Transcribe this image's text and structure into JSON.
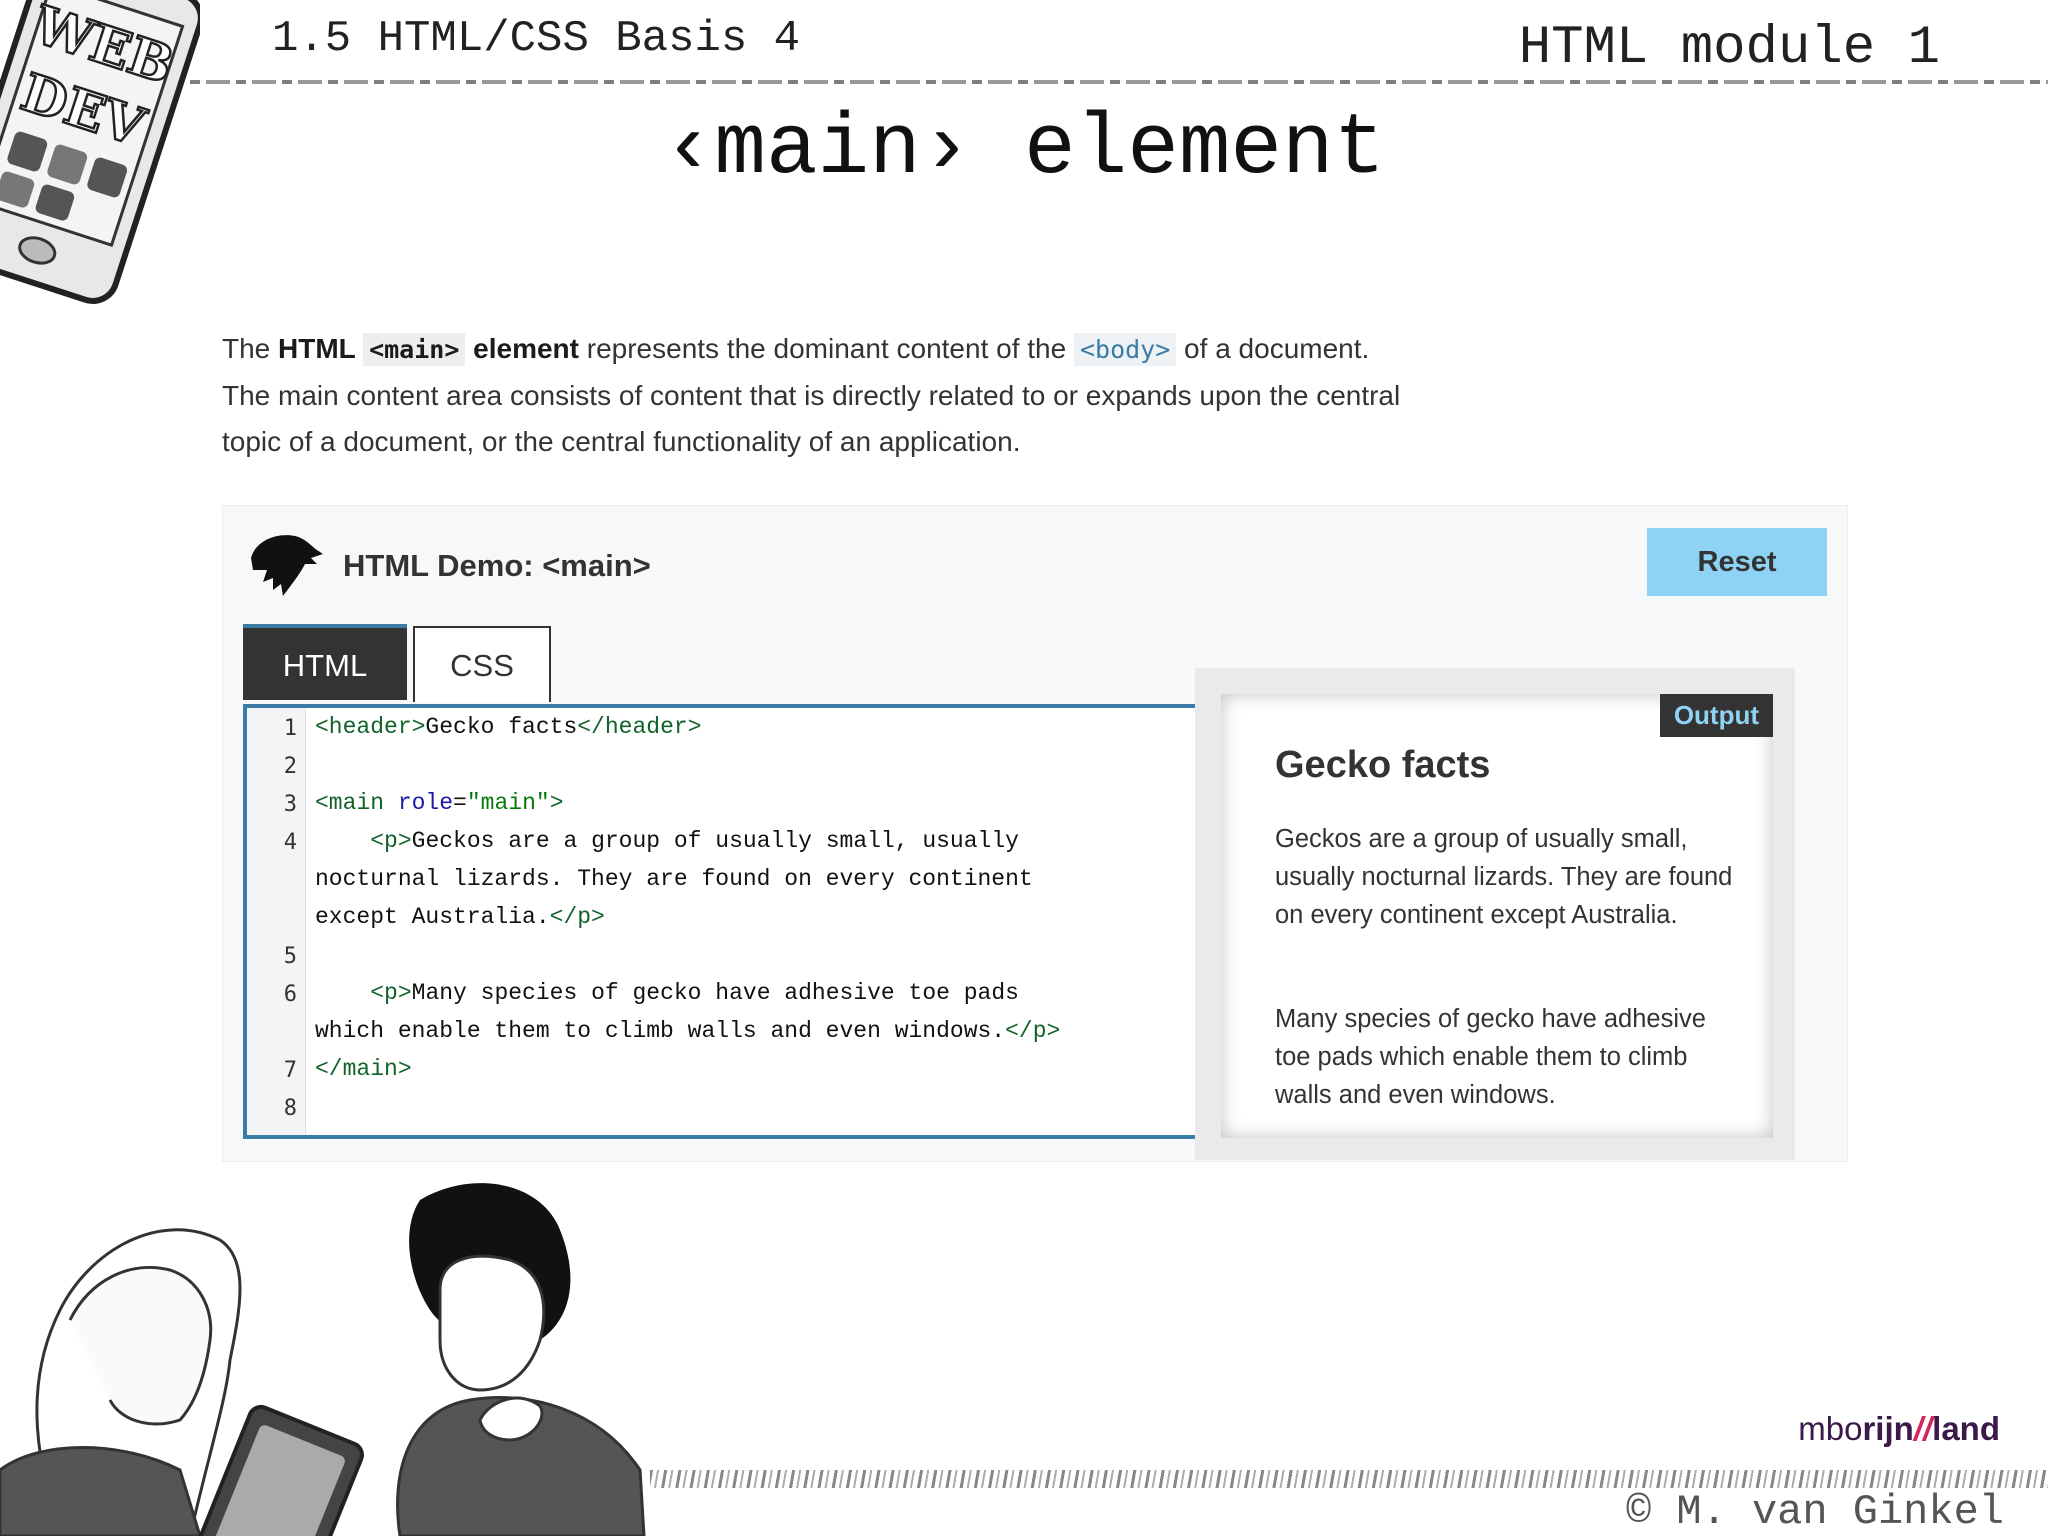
{
  "header": {
    "course": "1.5 HTML/CSS Basis 4",
    "module": "HTML module 1",
    "title": "‹main› element"
  },
  "phone": {
    "lines": [
      "WEB",
      "DEV"
    ]
  },
  "intro": {
    "w1": "The ",
    "w2": "HTML ",
    "w3": "<main>",
    "w4": " element",
    "w5": " represents the dominant content of the ",
    "w6": "<body>",
    "w7": " of a document.",
    "line2": "The main content area consists of content that is directly related to or expands upon the central",
    "line3": "topic of a document, or the central functionality of an application."
  },
  "demo": {
    "title": "HTML Demo: <main>",
    "reset_label": "Reset",
    "tabs": [
      {
        "label": "HTML",
        "active": true
      },
      {
        "label": "CSS",
        "active": false
      }
    ],
    "line_numbers": [
      "1",
      "2",
      "3",
      "4",
      "5",
      "6",
      "7",
      "8"
    ],
    "code": {
      "l1a": "<header>",
      "l1b": "Gecko facts",
      "l1c": "</header>",
      "l3a": "<main ",
      "l3b": "role",
      "l3c": "=",
      "l3d": "\"main\"",
      "l3e": ">",
      "l4a": "    ",
      "l4b": "<p>",
      "l4c": "Geckos are a group of usually small, usually",
      "l4d": "nocturnal lizards. They are found on every continent",
      "l4e": "except Australia.",
      "l4f": "</p>",
      "l6a": "    ",
      "l6b": "<p>",
      "l6c": "Many species of gecko have adhesive toe pads",
      "l6d": "which enable them to climb walls and even windows.",
      "l6e": "</p>",
      "l7a": "</main>"
    },
    "output": {
      "label": "Output",
      "heading": "Gecko facts",
      "p1": "Geckos are a group of usually small, usually nocturnal lizards. They are found on every continent except Australia.",
      "p2": "Many species of gecko have adhesive toe pads which enable them to climb walls and even windows."
    }
  },
  "footer": {
    "brand_a": "mbo",
    "brand_b": "rijn",
    "brand_c": "//",
    "brand_d": "land",
    "copyright": "© M. van Ginkel"
  },
  "colors": {
    "accent_blue": "#3a7ca5",
    "reset_bg": "#8fd3f4",
    "tag_green": "#116329",
    "attr_blue": "#1c1aa6",
    "brand_purple": "#3b1a4a",
    "brand_pink": "#d6245c"
  }
}
